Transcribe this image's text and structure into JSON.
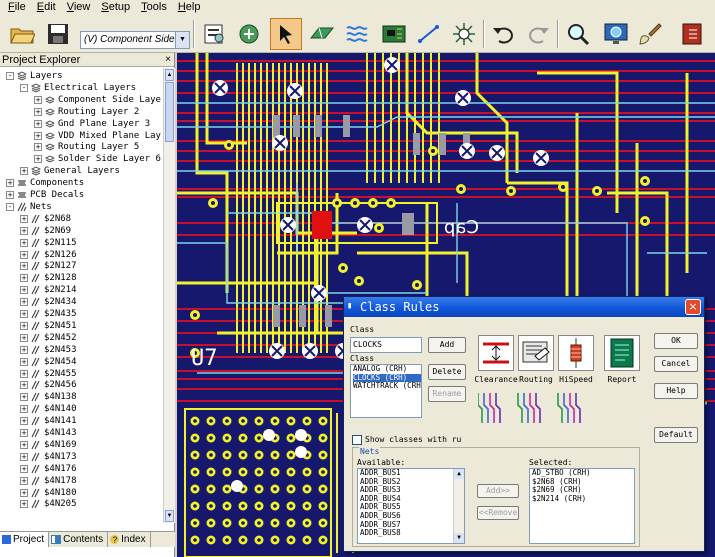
{
  "menu": [
    "File",
    "Edit",
    "View",
    "Setup",
    "Tools",
    "Help"
  ],
  "toolbar": {
    "layer_combo": "(V) Component Side L",
    "icons": [
      "open-folder-icon",
      "save-icon",
      "properties-icon",
      "route-icon",
      "select-arrow-icon",
      "design-toolbar-icon",
      "drafting-toolbar-icon",
      "pcb-icon",
      "trace-icon",
      "via-icon",
      "undo-icon",
      "redo-icon",
      "zoom-icon",
      "zoom-area-icon",
      "brush-icon",
      "exit-icon"
    ]
  },
  "explorer": {
    "title": "Project Explorer",
    "close": "×",
    "tree": [
      {
        "label": "Layers",
        "level": 0,
        "exp": "-",
        "icon": "layers"
      },
      {
        "label": "Electrical Layers",
        "level": 1,
        "exp": "-",
        "icon": "layers"
      },
      {
        "label": "Component Side Laye",
        "level": 2,
        "exp": "+",
        "icon": "layer"
      },
      {
        "label": "Routing Layer 2",
        "level": 2,
        "exp": "+",
        "icon": "layer"
      },
      {
        "label": "Gnd Plane Layer 3",
        "level": 2,
        "exp": "+",
        "icon": "layer"
      },
      {
        "label": "VDD Mixed Plane Lay",
        "level": 2,
        "exp": "+",
        "icon": "layer"
      },
      {
        "label": "Routing Layer 5",
        "level": 2,
        "exp": "+",
        "icon": "layer"
      },
      {
        "label": "Solder Side Layer 6",
        "level": 2,
        "exp": "+",
        "icon": "layer"
      },
      {
        "label": "General Layers",
        "level": 1,
        "exp": "+",
        "icon": "layers"
      },
      {
        "label": "Components",
        "level": 0,
        "exp": "+",
        "icon": "component"
      },
      {
        "label": "PCB Decals",
        "level": 0,
        "exp": "+",
        "icon": "component"
      },
      {
        "label": "Nets",
        "level": 0,
        "exp": "-",
        "icon": "nets"
      },
      {
        "label": "$2N68",
        "level": 1,
        "exp": "+",
        "icon": "net"
      },
      {
        "label": "$2N69",
        "level": 1,
        "exp": "+",
        "icon": "net"
      },
      {
        "label": "$2N115",
        "level": 1,
        "exp": "+",
        "icon": "net"
      },
      {
        "label": "$2N126",
        "level": 1,
        "exp": "+",
        "icon": "net"
      },
      {
        "label": "$2N127",
        "level": 1,
        "exp": "+",
        "icon": "net"
      },
      {
        "label": "$2N128",
        "level": 1,
        "exp": "+",
        "icon": "net"
      },
      {
        "label": "$2N214",
        "level": 1,
        "exp": "+",
        "icon": "net"
      },
      {
        "label": "$2N434",
        "level": 1,
        "exp": "+",
        "icon": "net"
      },
      {
        "label": "$2N435",
        "level": 1,
        "exp": "+",
        "icon": "net"
      },
      {
        "label": "$2N451",
        "level": 1,
        "exp": "+",
        "icon": "net"
      },
      {
        "label": "$2N452",
        "level": 1,
        "exp": "+",
        "icon": "net"
      },
      {
        "label": "$2N453",
        "level": 1,
        "exp": "+",
        "icon": "net"
      },
      {
        "label": "$2N454",
        "level": 1,
        "exp": "+",
        "icon": "net"
      },
      {
        "label": "$2N455",
        "level": 1,
        "exp": "+",
        "icon": "net"
      },
      {
        "label": "$2N456",
        "level": 1,
        "exp": "+",
        "icon": "net"
      },
      {
        "label": "$4N138",
        "level": 1,
        "exp": "+",
        "icon": "net"
      },
      {
        "label": "$4N140",
        "level": 1,
        "exp": "+",
        "icon": "net"
      },
      {
        "label": "$4N141",
        "level": 1,
        "exp": "+",
        "icon": "net"
      },
      {
        "label": "$4N143",
        "level": 1,
        "exp": "+",
        "icon": "net"
      },
      {
        "label": "$4N169",
        "level": 1,
        "exp": "+",
        "icon": "net"
      },
      {
        "label": "$4N173",
        "level": 1,
        "exp": "+",
        "icon": "net"
      },
      {
        "label": "$4N176",
        "level": 1,
        "exp": "+",
        "icon": "net"
      },
      {
        "label": "$4N178",
        "level": 1,
        "exp": "+",
        "icon": "net"
      },
      {
        "label": "$4N180",
        "level": 1,
        "exp": "+",
        "icon": "net"
      },
      {
        "label": "$4N205",
        "level": 1,
        "exp": "+",
        "icon": "net"
      }
    ],
    "tabs": [
      "Project",
      "Contents",
      "Index"
    ]
  },
  "canvas": {
    "ref_label": "U7",
    "mirrored_label": "Cap",
    "colors": {
      "background": "#16186e",
      "trace_yellow": "#f2f22a",
      "trace_red": "#c8102e",
      "trace_cyan": "#7fd6e8",
      "pad_gray": "#9a9aa6",
      "pad_white": "#ffffff"
    }
  },
  "dialog": {
    "title": "Class Rules",
    "close": "×",
    "class_label": "Class",
    "class_input": "CLOCKS",
    "add": "Add",
    "class_list_label": "Class",
    "class_list": [
      "ANALOG  (CRH)",
      "CLOCKS  (CRH)",
      "WATCHTRACK  (CRH)"
    ],
    "class_list_selected": 1,
    "delete": "Delete",
    "rename": "Rename",
    "rules": [
      "Clearance",
      "Routing",
      "HiSpeed",
      "Report"
    ],
    "ok": "OK",
    "cancel": "Cancel",
    "help": "Help",
    "default": "Default",
    "show_classes": "Show classes with ru",
    "nets_group": "Nets",
    "available_label": "Available:",
    "available": [
      "ADDR_BUS1",
      "ADDR_BUS2",
      "ADDR_BUS3",
      "ADDR_BUS4",
      "ADDR_BUS5",
      "ADDR_BUS6",
      "ADDR_BUS7",
      "ADDR_BUS8"
    ],
    "add_net": "Add>>",
    "remove_net": "<<Remove",
    "selected_label": "Selected:",
    "selected": [
      "AD_STBO  (CRH)",
      "$2N68  (CRH)",
      "$2N69  (CRH)",
      "$2N214  (CRH)"
    ]
  }
}
